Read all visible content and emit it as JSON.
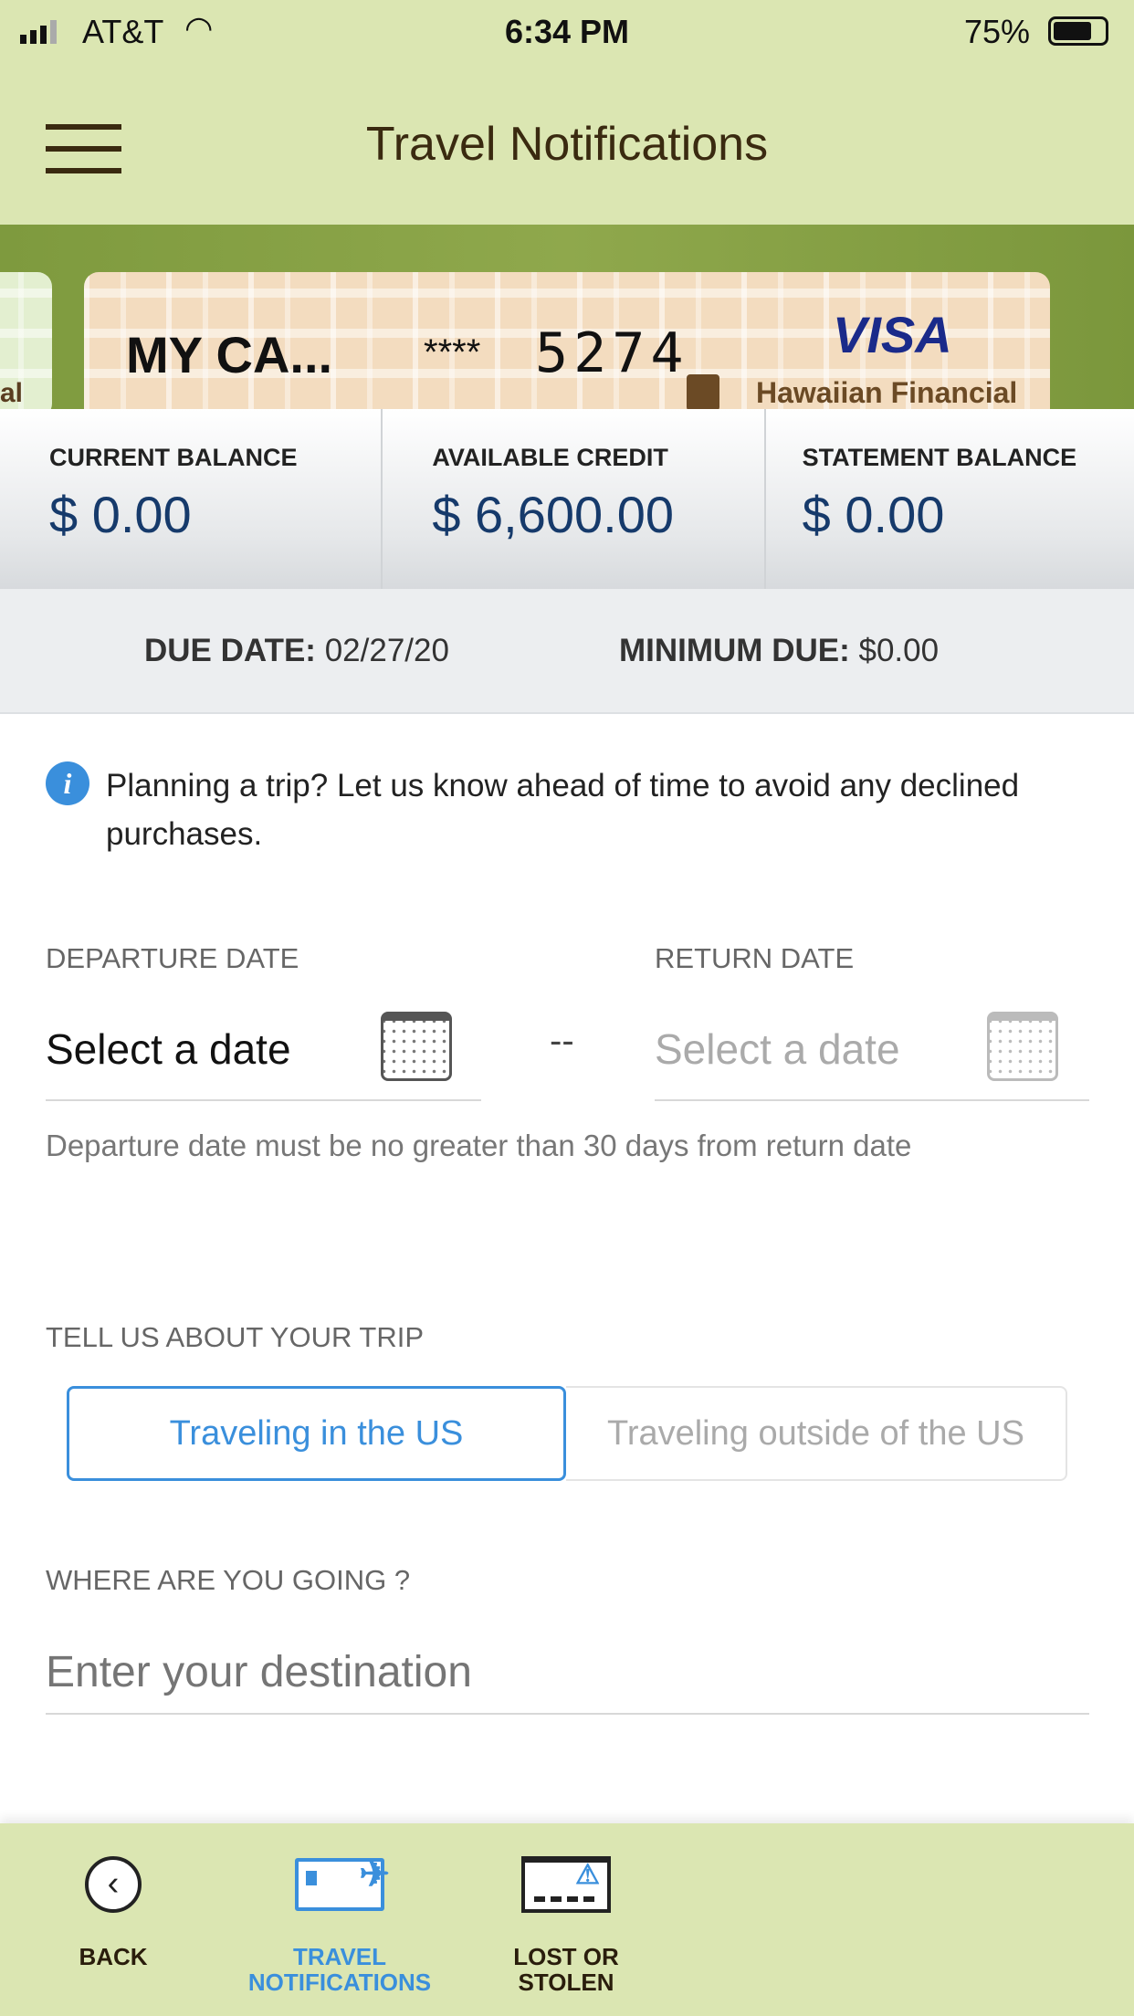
{
  "status_bar": {
    "carrier": "AT&T",
    "time": "6:34 PM",
    "battery": "75%"
  },
  "header": {
    "title": "Travel Notifications",
    "menu_icon": "hamburger-icon"
  },
  "card": {
    "name": "MY CA...",
    "masked": "****",
    "last4": "5274",
    "network": "VISA",
    "issuer": "Hawaiian Financial",
    "prev_card_fragment": "al"
  },
  "balances": [
    {
      "label": "CURRENT BALANCE",
      "value": "$ 0.00"
    },
    {
      "label": "AVAILABLE CREDIT",
      "value": "$ 6,600.00"
    },
    {
      "label": "STATEMENT BALANCE",
      "value": "$ 0.00"
    }
  ],
  "due": {
    "due_label": "DUE DATE:",
    "due_value": "02/27/20",
    "min_label": "MINIMUM DUE:",
    "min_value": "$0.00"
  },
  "info": {
    "text": "Planning a trip? Let us know ahead of time to avoid any declined purchases."
  },
  "departure": {
    "label": "DEPARTURE DATE",
    "value": "Select a date"
  },
  "separator": "--",
  "return": {
    "label": "RETURN DATE",
    "placeholder": "Select a date"
  },
  "hint": "Departure date must be no greater than 30 days from return date",
  "trip": {
    "label": "TELL US ABOUT YOUR TRIP",
    "options": [
      "Traveling in the US",
      "Traveling outside of the US"
    ],
    "selected": 0
  },
  "destination": {
    "label": "WHERE ARE YOU GOING ?",
    "placeholder": "Enter your destination"
  },
  "nav": [
    {
      "label": "BACK",
      "icon": "back-circle-icon"
    },
    {
      "label": "TRAVEL NOTIFICATIONS",
      "icon": "card-plane-icon",
      "active": true
    },
    {
      "label": "LOST OR STOLEN",
      "icon": "card-warning-icon"
    }
  ],
  "colors": {
    "header_bg": "#dbe6b2",
    "accent": "#3a8fdc",
    "balance_value": "#163a6b"
  }
}
